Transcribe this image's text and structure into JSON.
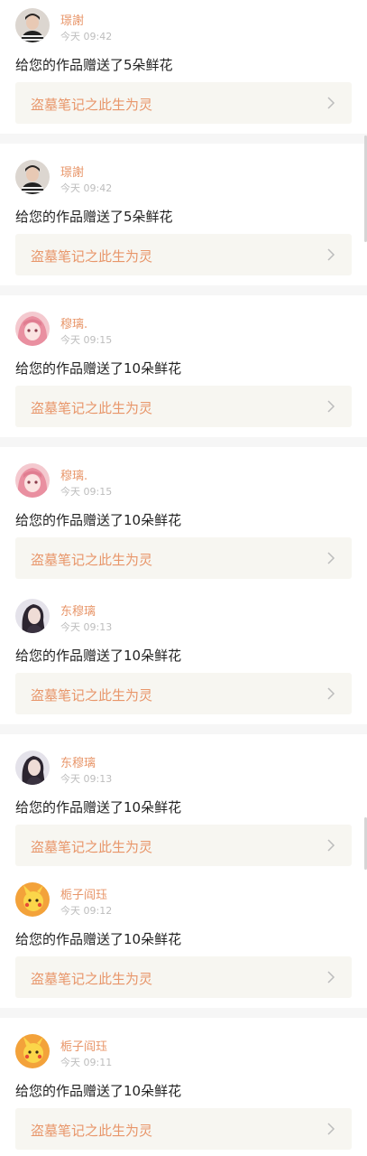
{
  "notifications": [
    {
      "username": "璟謝",
      "time": "今天 09:42",
      "message": "给您的作品赠送了5朵鲜花",
      "work_title": "盗墓笔记之此生为灵",
      "avatar_icon": "avatar-striped-shirt-icon"
    },
    {
      "username": "璟謝",
      "time": "今天 09:42",
      "message": "给您的作品赠送了5朵鲜花",
      "work_title": "盗墓笔记之此生为灵",
      "avatar_icon": "avatar-striped-shirt-icon"
    },
    {
      "username": "穆璃.",
      "time": "今天 09:15",
      "message": "给您的作品赠送了10朵鲜花",
      "work_title": "盗墓笔记之此生为灵",
      "avatar_icon": "avatar-pink-anime-icon"
    },
    {
      "username": "穆璃.",
      "time": "今天 09:15",
      "message": "给您的作品赠送了10朵鲜花",
      "work_title": "盗墓笔记之此生为灵",
      "avatar_icon": "avatar-pink-anime-icon"
    },
    {
      "username": "东穆璃",
      "time": "今天 09:13",
      "message": "给您的作品赠送了10朵鲜花",
      "work_title": "盗墓笔记之此生为灵",
      "avatar_icon": "avatar-dark-hair-girl-icon"
    },
    {
      "username": "东穆璃",
      "time": "今天 09:13",
      "message": "给您的作品赠送了10朵鲜花",
      "work_title": "盗墓笔记之此生为灵",
      "avatar_icon": "avatar-dark-hair-girl-icon"
    },
    {
      "username": "栀子阎珏",
      "time": "今天 09:12",
      "message": "给您的作品赠送了10朵鲜花",
      "work_title": "盗墓笔记之此生为灵",
      "avatar_icon": "avatar-yellow-cartoon-icon"
    },
    {
      "username": "栀子阎珏",
      "time": "今天 09:11",
      "message": "给您的作品赠送了10朵鲜花",
      "work_title": "盗墓笔记之此生为灵",
      "avatar_icon": "avatar-yellow-cartoon-icon"
    }
  ],
  "colors": {
    "accent": "#e8966a",
    "timestamp": "#bdbdbd",
    "message": "#222222",
    "link_background": "#f7f6f1",
    "separator": "#f6f6f6"
  }
}
